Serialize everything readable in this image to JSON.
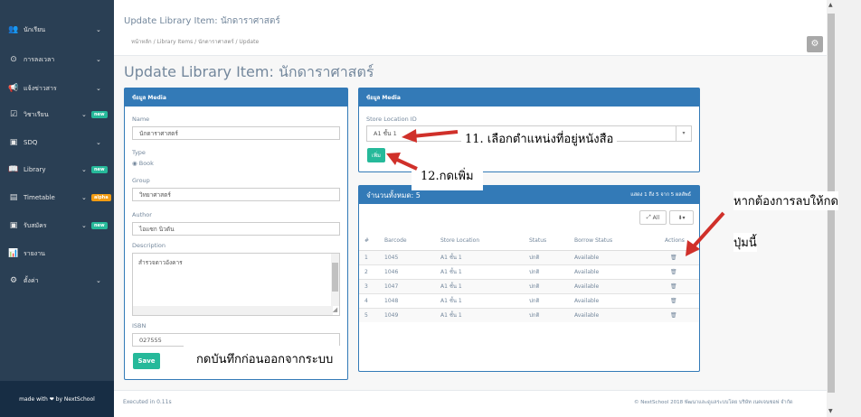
{
  "sidebar": {
    "items": [
      {
        "label": "นักเรียน",
        "icon": "users-icon",
        "glyph": "👥"
      },
      {
        "label": "การลงเวลา",
        "icon": "clock-icon",
        "glyph": "⊙"
      },
      {
        "label": "แจ้งข่าวสาร",
        "icon": "bullhorn-icon",
        "glyph": "📢"
      },
      {
        "label": "วิชาเรียน",
        "icon": "calendar-icon",
        "glyph": "☑"
      },
      {
        "label": "SDQ",
        "icon": "square-icon",
        "glyph": "▣"
      },
      {
        "label": "Library",
        "icon": "book-icon",
        "glyph": "📖"
      },
      {
        "label": "Timetable",
        "icon": "table-icon",
        "glyph": "▤"
      },
      {
        "label": "รับสมัคร",
        "icon": "form-icon",
        "glyph": "▣"
      },
      {
        "label": "รายงาน",
        "icon": "chart-icon",
        "glyph": "📊"
      },
      {
        "label": "ตั้งค่า",
        "icon": "cogs-icon",
        "glyph": "⚙"
      }
    ],
    "badges": {
      "new": "new",
      "alpha": "alpha"
    },
    "footer": "made with ❤ by NextSchool"
  },
  "header": {
    "title": "Update Library Item: นักดาราศาสตร์",
    "breadcrumb": "หน้าหลัก  /  Library Items  /  นักดาราศาสตร์  /  Update",
    "gear_glyph": "⚙"
  },
  "page_title": "Update Library Item: นักดาราศาสตร์",
  "media_panel": {
    "heading": "ข้อมูล Media",
    "name_label": "Name",
    "name_value": "นักดาราศาสตร์",
    "type_label": "Type",
    "type_option": "Book",
    "group_label": "Group",
    "group_value": "วิทยาศาสตร์",
    "author_label": "Author",
    "author_value": "ไอแซก นิวตัน",
    "description_label": "Description",
    "description_value": "สำรวจดาวอังคาร",
    "isbn_label": "ISBN",
    "isbn_value": "027555",
    "save_label": "Save"
  },
  "store_panel": {
    "heading": "ข้อมูล Media",
    "location_label": "Store Location ID",
    "location_value": "A1 ชั้น 1",
    "add_label": "เพิ่ม"
  },
  "stock_panel": {
    "heading": "จำนวนทั้งหมด: 5",
    "summary": "แสดง 1 ถึง 5 จาก 5 ผลลัพธ์",
    "all_label": "All",
    "columns": [
      "#",
      "Barcode",
      "Store Location",
      "Status",
      "Borrow Status",
      "Actions"
    ],
    "rows": [
      {
        "n": "1",
        "barcode": "1045",
        "location": "A1 ชั้น 1",
        "status": "ปกติ",
        "borrow": "Available"
      },
      {
        "n": "2",
        "barcode": "1046",
        "location": "A1 ชั้น 1",
        "status": "ปกติ",
        "borrow": "Available"
      },
      {
        "n": "3",
        "barcode": "1047",
        "location": "A1 ชั้น 1",
        "status": "ปกติ",
        "borrow": "Available"
      },
      {
        "n": "4",
        "barcode": "1048",
        "location": "A1 ชั้น 1",
        "status": "ปกติ",
        "borrow": "Available"
      },
      {
        "n": "5",
        "barcode": "1049",
        "location": "A1 ชั้น 1",
        "status": "ปกติ",
        "borrow": "Available"
      }
    ]
  },
  "footer": {
    "left": "Executed in 0.11s",
    "right": "© NextSchool 2018 พัฒนาและดูแลระบบโดย บริษัท เนคเจนซอฟ จำกัด"
  },
  "annotations": {
    "step11": "11. เลือกตำแหน่งที่อยู่หนังสือ",
    "step12": "12.กดเพิ่ม",
    "delete_hint_1": "หากต้องการลบให้กด",
    "delete_hint_2": "ปุ่มนี้",
    "save_hint": "กดบันทึกก่อนออกจากระบบ"
  },
  "colors": {
    "sidebar": "#2a3f54",
    "accent": "#337ab7",
    "green": "#26b99a",
    "arrow": "#d0302a"
  }
}
